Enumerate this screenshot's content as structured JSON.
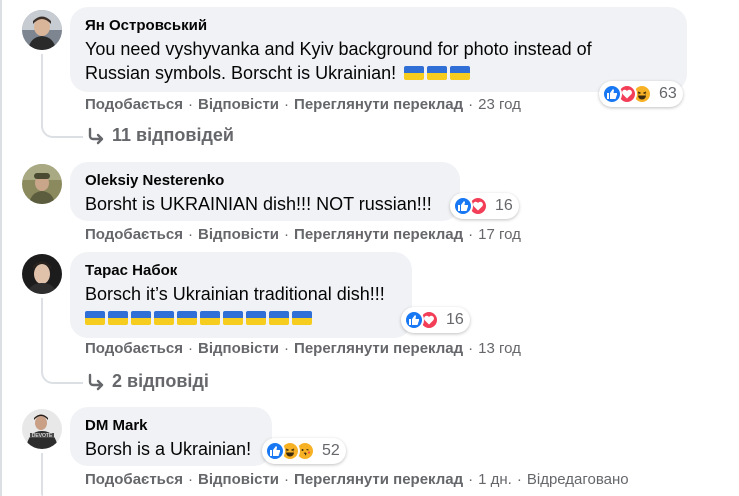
{
  "comments": [
    {
      "author": "Ян Островський",
      "text_line1": "You need vyshyvanka and Kyiv background for photo instead of",
      "text_line2": "Russian symbols. Borscht is Ukrainian!",
      "flags": 3,
      "reaction_count": "63",
      "time": "23 год",
      "replies": "11 відповідей"
    },
    {
      "author": "Oleksiy Nesterenko",
      "text": "Borsht is UKRAINIAN dish!!! NOT russian!!!",
      "reaction_count": "16",
      "time": "17 год"
    },
    {
      "author": "Тарас Набок",
      "text": "Borsch it’s Ukrainian traditional dish!!!",
      "flags": 10,
      "reaction_count": "16",
      "time": "13 год",
      "replies": "2 відповіді"
    },
    {
      "author": "DM Mark",
      "text": "Borsh is a Ukrainian!",
      "reaction_count": "52",
      "time": "1 дн.",
      "edited": "Відредаговано"
    }
  ],
  "labels": {
    "like": "Подобається",
    "reply": "Відповісти",
    "translate": "Переглянути переклад",
    "dot": "·"
  },
  "colors": {
    "bubble": "#f0f2f5",
    "secondary_text": "#65676b",
    "like_blue": "#1877f2",
    "love_red": "#f33e58",
    "flag_blue": "#2f6fd6",
    "flag_yellow": "#f6cc1e"
  }
}
